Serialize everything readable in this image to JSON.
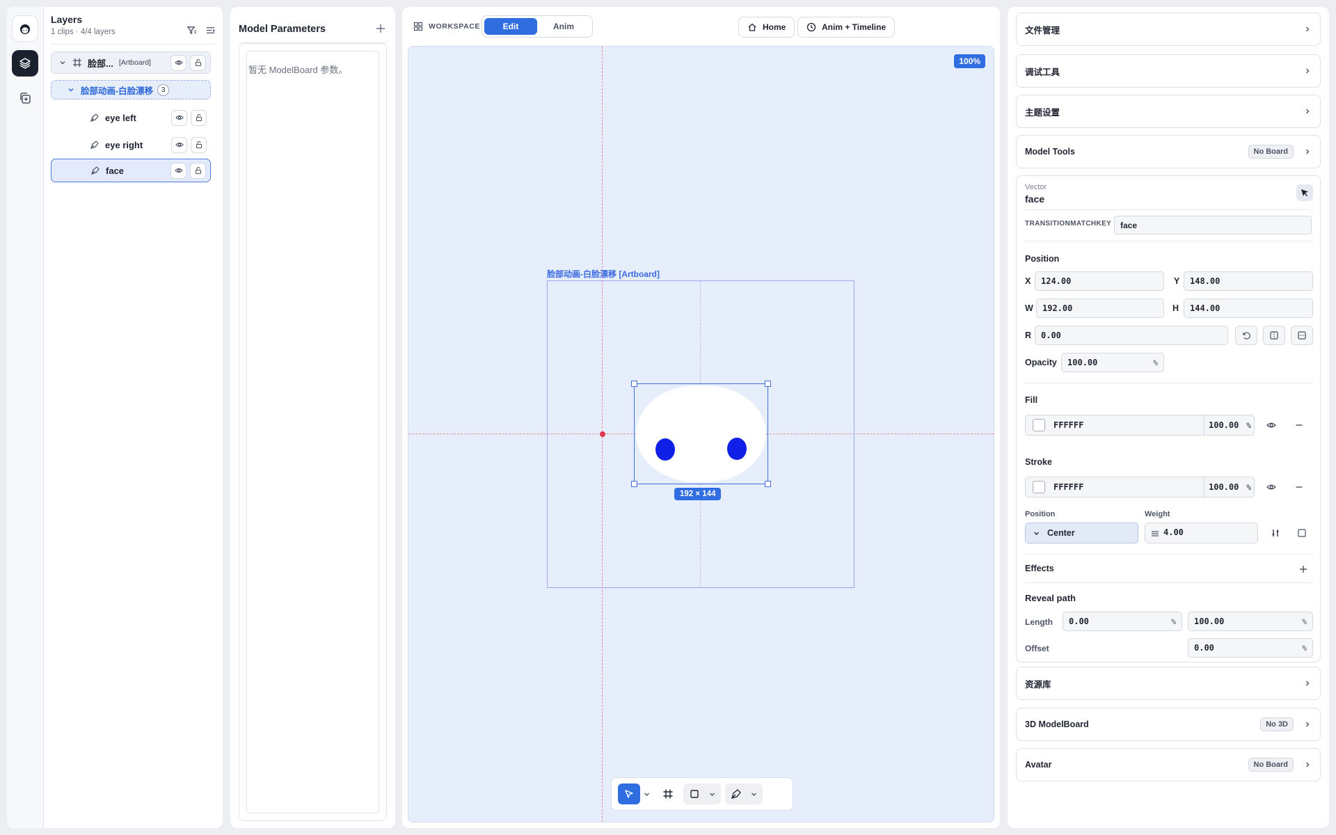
{
  "layers": {
    "title": "Layers",
    "subtitle": "1 clips · 4/4 layers",
    "root": {
      "label": "脸部...",
      "tag": "[Artboard]"
    },
    "group": {
      "label": "脸部动画-白脸漂移",
      "count": "3"
    },
    "items": [
      {
        "label": "eye left"
      },
      {
        "label": "eye right"
      },
      {
        "label": "face"
      }
    ]
  },
  "params": {
    "title": "Model Parameters",
    "empty": "暂无 ModelBoard 参数。"
  },
  "workspace": {
    "label": "WORKSPACE",
    "modes": [
      "Edit",
      "Anim"
    ],
    "home": "Home",
    "timeline": "Anim + Timeline",
    "zoom": "100%",
    "artboard_label": "脸部动画-白脸漂移 [Artboard]",
    "selection_dims": "192 × 144"
  },
  "inspector": {
    "sections_top": [
      {
        "label": "文件管理"
      },
      {
        "label": "调试工具"
      },
      {
        "label": "主题设置"
      }
    ],
    "model_tools": {
      "label": "Model Tools",
      "badge": "No Board"
    },
    "vector": {
      "type": "Vector",
      "name": "face",
      "key_label": "TRANSITIONMATCHKEY",
      "key_value": "face",
      "position_title": "Position",
      "x_label": "X",
      "x": "124.00",
      "y_label": "Y",
      "y": "148.00",
      "w_label": "W",
      "w": "192.00",
      "h_label": "H",
      "h": "144.00",
      "r_label": "R",
      "r": "0.00",
      "opacity_label": "Opacity",
      "opacity": "100.00",
      "pct": "%",
      "fill_title": "Fill",
      "fill_hex": "FFFFFF",
      "fill_pct": "100.00",
      "stroke_title": "Stroke",
      "stroke_hex": "FFFFFF",
      "stroke_pct": "100.00",
      "stroke_pos_label": "Position",
      "stroke_pos": "Center",
      "weight_label": "Weight",
      "weight": "4.00",
      "effects_title": "Effects",
      "reveal_title": "Reveal path",
      "length_label": "Length",
      "length_start": "0.00",
      "length_end": "100.00",
      "offset_label": "Offset",
      "offset": "0.00"
    },
    "sections_bottom": [
      {
        "label": "资源库"
      }
    ],
    "modelboard3d": {
      "label": "3D ModelBoard",
      "badge": "No 3D"
    },
    "avatar": {
      "label": "Avatar",
      "badge": "No Board"
    }
  },
  "colors": {
    "accent": "#2f6de1",
    "canvas": "#e6edfb",
    "eye": "#1020e6",
    "guide": "#e68a9a"
  }
}
